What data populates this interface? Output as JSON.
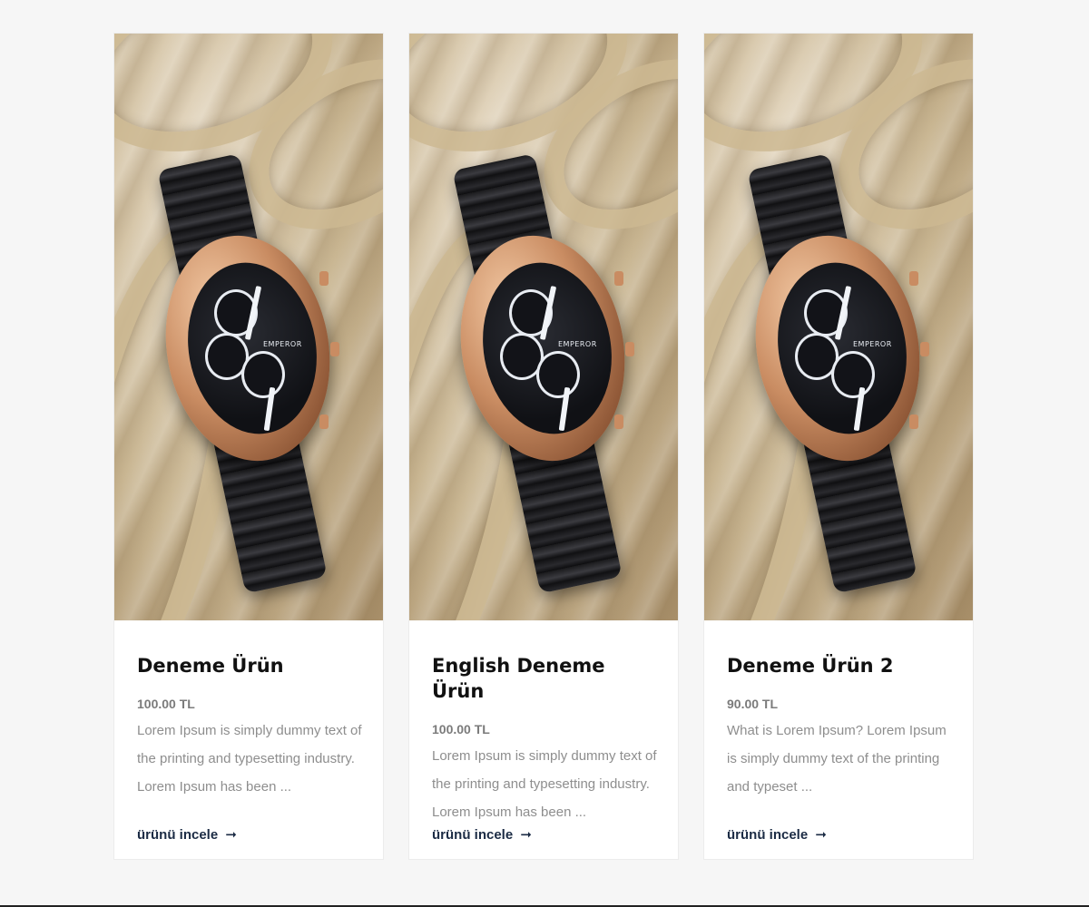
{
  "products": [
    {
      "title": "Deneme Ürün",
      "price": "100.00 TL",
      "description": "Lorem Ipsum is simply dummy text of the printing and typesetting industry. Lorem Ipsum has been ...",
      "link": "ürünü incele",
      "image_brand": "EMPEROR"
    },
    {
      "title": "English Deneme Ürün",
      "price": "100.00 TL",
      "description": "Lorem Ipsum is simply dummy text of the printing and typesetting industry. Lorem Ipsum has been ...",
      "link": "ürünü incele",
      "image_brand": "EMPEROR"
    },
    {
      "title": "Deneme Ürün 2",
      "price": "90.00 TL",
      "description": "What is Lorem Ipsum? Lorem Ipsum is simply dummy text of the printing and typeset ...",
      "link": "ürünü incele",
      "image_brand": "EMPEROR"
    }
  ],
  "icons": {
    "link_arrow": "right-arrow-icon"
  },
  "colors": {
    "page_background": "#f6f6f6",
    "card_background": "#ffffff",
    "title": "#111111",
    "price": "#7b7b7b",
    "description": "#8e8e8e",
    "link": "#1b2b44"
  }
}
